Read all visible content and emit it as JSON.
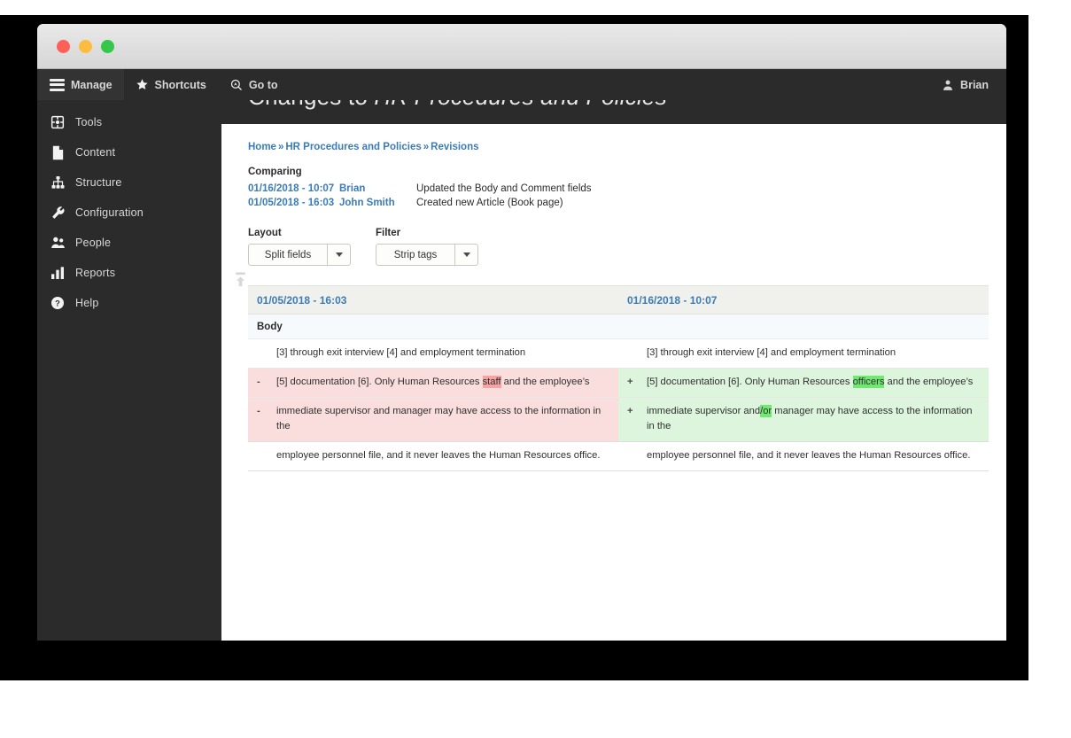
{
  "window": {
    "traffic_lights": [
      "close",
      "minimize",
      "maximize"
    ]
  },
  "topbar": {
    "manage_label": "Manage",
    "shortcuts_label": "Shortcuts",
    "goto_label": "Go to",
    "user_label": "Brian",
    "icons": {
      "manage": "hamburger-icon",
      "shortcuts": "star-icon",
      "goto": "compass-icon",
      "user": "user-avatar-icon"
    }
  },
  "sidebar": {
    "items": [
      {
        "label": "Tools",
        "icon": "tools-icon"
      },
      {
        "label": "Content",
        "icon": "document-icon"
      },
      {
        "label": "Structure",
        "icon": "sitemap-icon"
      },
      {
        "label": "Configuration",
        "icon": "wrench-icon"
      },
      {
        "label": "People",
        "icon": "people-icon"
      },
      {
        "label": "Reports",
        "icon": "bar-chart-icon"
      },
      {
        "label": "Help",
        "icon": "question-circle-icon"
      }
    ],
    "collapse_icon": "collapse-up-icon"
  },
  "page": {
    "title_prefix": "Changes to ",
    "title_emphasis": "HR Procedures and Policies"
  },
  "breadcrumb": {
    "items": [
      "Home",
      "HR Procedures and Policies",
      "Revisions"
    ],
    "separator": "»"
  },
  "comparing": {
    "heading": "Comparing",
    "rows": [
      {
        "date": "01/16/2018 - 10:07",
        "user": "Brian",
        "description": "Updated the Body and Comment fields"
      },
      {
        "date": "01/05/2018 - 16:03",
        "user": "John Smith",
        "description": "Created new Article (Book page)"
      }
    ]
  },
  "controls": {
    "layout": {
      "label": "Layout",
      "value": "Split fields"
    },
    "filter": {
      "label": "Filter",
      "value": "Strip tags"
    }
  },
  "diff": {
    "left_header": "01/05/2018 - 16:03",
    "right_header": "01/16/2018 - 10:07",
    "section_label": "Body",
    "rows": [
      {
        "type": "context",
        "left": {
          "sign": "",
          "text": "[3] through exit interview [4] and employment termination"
        },
        "right": {
          "sign": "",
          "text": "[3] through exit interview [4] and employment termination"
        }
      },
      {
        "type": "change",
        "left": {
          "sign": "-",
          "pre": "[5] documentation [6]. Only Human Resources ",
          "hl": "staff",
          "post": " and the employee’s"
        },
        "right": {
          "sign": "+",
          "pre": "[5] documentation [6]. Only Human Resources ",
          "hl": "officers",
          "post": " and the employee’s"
        }
      },
      {
        "type": "change",
        "left": {
          "sign": "-",
          "pre": "immediate supervisor and manager may have access to the information in the",
          "hl": "",
          "post": ""
        },
        "right": {
          "sign": "+",
          "pre": "immediate supervisor and",
          "hl": "/or",
          "post": " manager may have access to the information in the"
        }
      },
      {
        "type": "context",
        "left": {
          "sign": "",
          "text": "employee personnel file, and it never leaves the Human Resources office."
        },
        "right": {
          "sign": "",
          "text": "employee personnel file, and it never leaves the Human Resources office."
        }
      }
    ]
  },
  "colors": {
    "chrome_dark": "#2b2b2b",
    "link_blue": "#3b7cb5",
    "diff_delete_bg": "#fadddd",
    "diff_insert_bg": "#ddf5dd",
    "diff_delete_hl": "#f7a3a3",
    "diff_insert_hl": "#71e871",
    "header_row_bg": "#f0f0ec",
    "section_row_bg": "#f7fafd"
  }
}
